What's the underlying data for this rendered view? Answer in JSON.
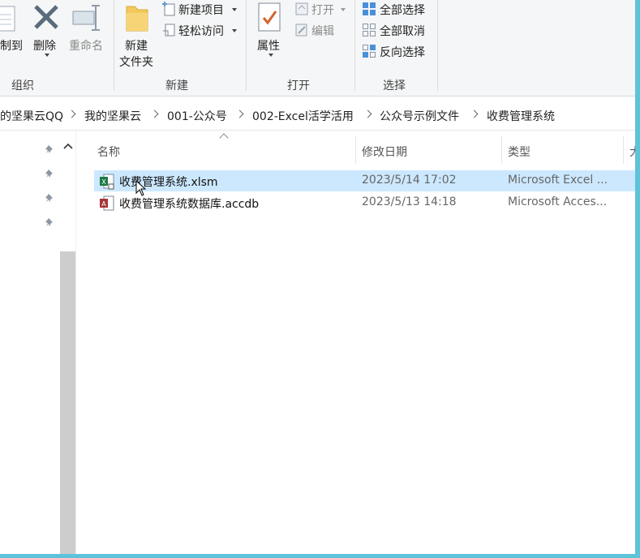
{
  "ribbon": {
    "clipboard_partial_label": "制到",
    "delete_label": "删除",
    "rename_label": "重命名",
    "new_folder_label_line1": "新建",
    "new_folder_label_line2": "文件夹",
    "new_item_label": "新建项目",
    "easy_access_label": "轻松访问",
    "properties_label": "属性",
    "open_label": "打开",
    "edit_label": "编辑",
    "select_all_label": "全部选择",
    "select_none_label": "全部取消",
    "invert_selection_label": "反向选择",
    "groups": {
      "organize": "组织",
      "new": "新建",
      "open": "打开",
      "select": "选择"
    }
  },
  "breadcrumb": [
    "的坚果云QQ",
    "我的坚果云",
    "001-公众号",
    "002-Excel活学活用",
    "公众号示例文件",
    "收费管理系统"
  ],
  "columns": {
    "name": "名称",
    "date": "修改日期",
    "type": "类型",
    "size": "大"
  },
  "files": [
    {
      "name": "收费管理系统.xlsm",
      "date": "2023/5/14 17:02",
      "type": "Microsoft Excel ..."
    },
    {
      "name": "收费管理系统数据库.accdb",
      "date": "2023/5/13 14:18",
      "type": "Microsoft Acces..."
    }
  ],
  "colors": {
    "selection": "#cce8ff",
    "frame": "#5cc3d9",
    "ribbon_bg": "#f5f6f7"
  }
}
